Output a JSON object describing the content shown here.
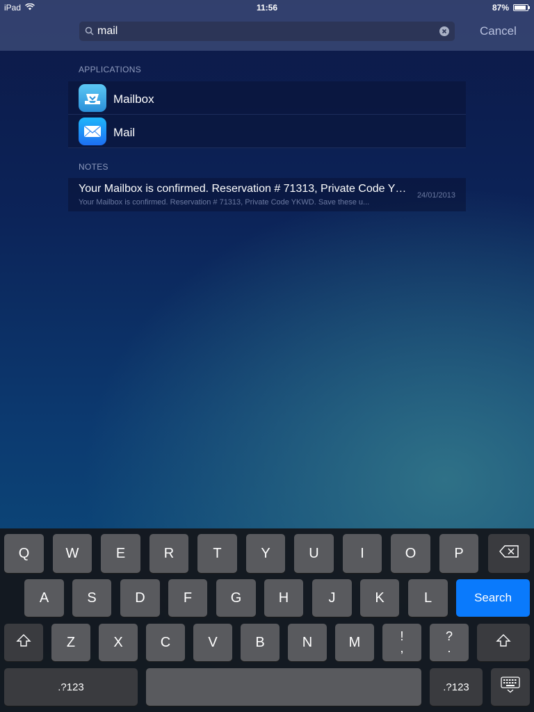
{
  "status_bar": {
    "device": "iPad",
    "time": "11:56",
    "battery_percent_label": "87%",
    "battery_level": 0.87,
    "icons": [
      "wifi-icon",
      "battery-icon"
    ]
  },
  "search": {
    "value": "mail",
    "cancel_label": "Cancel",
    "icons": [
      "search-icon",
      "clear-icon"
    ]
  },
  "results": {
    "applications_header": "APPLICATIONS",
    "applications": [
      {
        "label": "Mailbox",
        "icon": "mailbox-app-icon"
      },
      {
        "label": "Mail",
        "icon": "mail-app-icon"
      }
    ],
    "notes_header": "NOTES",
    "note": {
      "title": "Your Mailbox is confirmed. Reservation # 71313, Private Code YKWD.",
      "body": "Your Mailbox is confirmed. Reservation # 71313, Private Code YKWD. Save these u...",
      "date": "24/01/2013"
    }
  },
  "keyboard": {
    "row1": [
      "Q",
      "W",
      "E",
      "R",
      "T",
      "Y",
      "U",
      "I",
      "O",
      "P"
    ],
    "row2": [
      "A",
      "S",
      "D",
      "F",
      "G",
      "H",
      "J",
      "K",
      "L"
    ],
    "row3": [
      "Z",
      "X",
      "C",
      "V",
      "B",
      "N",
      "M"
    ],
    "punct1": [
      "!",
      ","
    ],
    "punct2": [
      "?",
      "."
    ],
    "search_label": "Search",
    "numbers_label": ".?123",
    "icons": [
      "backspace-icon",
      "shift-icon",
      "keyboard-dismiss-icon"
    ]
  },
  "colors": {
    "accent_blue": "#0a7afc",
    "background_top": "#0d1947",
    "background_bottom": "#0c5581"
  }
}
